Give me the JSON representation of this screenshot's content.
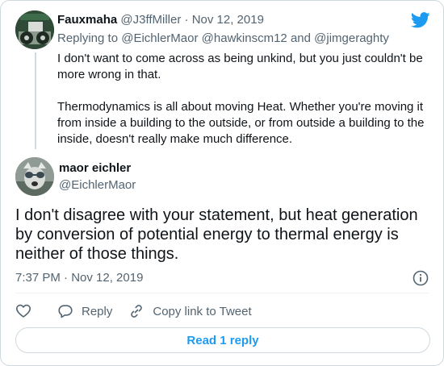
{
  "parent_tweet": {
    "display_name": "Fauxmaha",
    "handle": "@J3ffMiller",
    "separator": "·",
    "date": "Nov 12, 2019",
    "replying_prefix": "Replying to",
    "replying_to": [
      "@EichlerMaor",
      "@hawkinscm12",
      "@jimgeraghty"
    ],
    "replying_and": "and",
    "paragraphs": [
      "I don't want to come across as being unkind, but you just couldn't be more wrong in that.",
      "Thermodynamics is all about moving Heat. Whether you're moving it from inside a building to the outside, or from outside a building to the inside, doesn't really make much difference."
    ]
  },
  "main_tweet": {
    "display_name": "maor eichler",
    "handle": "@EichlerMaor",
    "text": "I don't disagree with your statement, but heat generation by conversion of potential energy to thermal energy is neither of those things.",
    "timestamp": "7:37 PM · Nov 12, 2019"
  },
  "actions": {
    "reply_label": "Reply",
    "copy_link_label": "Copy link to Tweet"
  },
  "read_replies_label": "Read 1 reply",
  "colors": {
    "brand": "#1d9bf0",
    "text": "#0f1419",
    "muted": "#536471",
    "border": "#cfd9de"
  },
  "icons": [
    "twitter-bird-icon",
    "info-icon",
    "heart-icon",
    "reply-icon",
    "link-icon"
  ]
}
